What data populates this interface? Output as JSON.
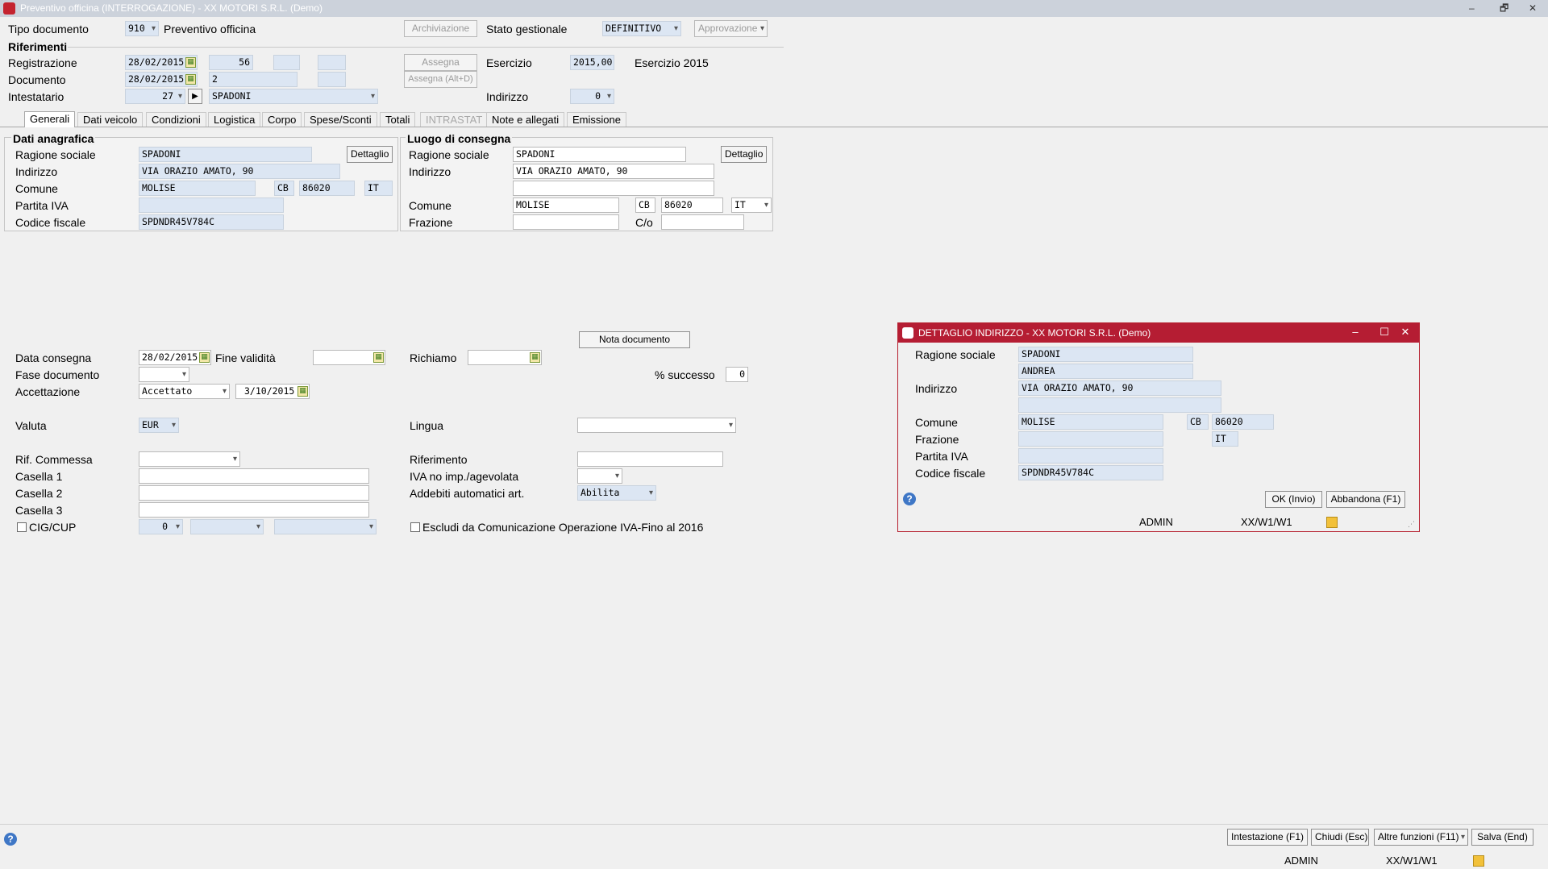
{
  "window": {
    "title": "Preventivo officina (INTERROGAZIONE) - XX  MOTORI S.R.L.  (Demo)",
    "minimize": "–",
    "restore": "🗗",
    "close": "✕"
  },
  "header": {
    "tipo_documento_label": "Tipo documento",
    "tipo_documento_code": "910",
    "tipo_documento_name": "Preventivo officina",
    "archiviazione_button": "Archiviazione",
    "stato_gestionale_label": "Stato gestionale",
    "stato_gestionale_value": "DEFINITIVO",
    "approvazione_button": "Approvazione",
    "riferimenti_title": "Riferimenti",
    "registrazione_label": "Registrazione",
    "registrazione_date": "28/02/2015",
    "registrazione_num": "56",
    "assegna_button": "Assegna",
    "esercizio_label": "Esercizio",
    "esercizio_value": "2015,00",
    "esercizio_desc": "Esercizio 2015",
    "documento_label": "Documento",
    "documento_date": "28/02/2015",
    "documento_num": "2",
    "assegna_alt_button": "Assegna (Alt+D)",
    "intestatario_label": "Intestatario",
    "intestatario_code": "27",
    "intestatario_name": "SPADONI",
    "indirizzo_label": "Indirizzo",
    "indirizzo_value": "0"
  },
  "tabs": [
    "Generali",
    "Dati veicolo",
    "Condizioni",
    "Logistica",
    "Corpo",
    "Spese/Sconti",
    "Totali",
    "INTRASTAT",
    "Note e allegati",
    "Emissione"
  ],
  "anagrafica": {
    "title": "Dati anagrafica",
    "ragione_sociale_label": "Ragione sociale",
    "ragione_sociale": "SPADONI",
    "dettaglio_button": "Dettaglio",
    "indirizzo_label": "Indirizzo",
    "indirizzo": "VIA ORAZIO AMATO, 90",
    "comune_label": "Comune",
    "comune": "MOLISE",
    "provincia": "CB",
    "cap": "86020",
    "nazione": "IT",
    "partita_iva_label": "Partita IVA",
    "partita_iva": "",
    "codice_fiscale_label": "Codice fiscale",
    "codice_fiscale": "SPDNDR45V784C"
  },
  "consegna": {
    "title": "Luogo di consegna",
    "ragione_sociale_label": "Ragione sociale",
    "ragione_sociale": "SPADONI",
    "dettaglio_button": "Dettaglio",
    "indirizzo_label": "Indirizzo",
    "indirizzo": "VIA ORAZIO AMATO, 90",
    "comune_label": "Comune",
    "comune": "MOLISE",
    "provincia": "CB",
    "cap": "86020",
    "nazione": "IT",
    "frazione_label": "Frazione",
    "co_label": "C/o"
  },
  "generali": {
    "nota_documento_button": "Nota documento",
    "data_consegna_label": "Data consegna",
    "data_consegna": "28/02/2015",
    "fine_validita_label": "Fine validità",
    "richiamo_label": "Richiamo",
    "fase_documento_label": "Fase documento",
    "successo_label": "% successo",
    "successo_value": "0",
    "accettazione_label": "Accettazione",
    "accettazione_value": "Accettato",
    "accettazione_date": "3/10/2015",
    "valuta_label": "Valuta",
    "valuta_value": "EUR",
    "lingua_label": "Lingua",
    "rif_commessa_label": "Rif. Commessa",
    "riferimento_label": "Riferimento",
    "casella1_label": "Casella 1",
    "iva_label": "IVA no imp./agevolata",
    "casella2_label": "Casella 2",
    "addebiti_label": "Addebiti automatici art.",
    "addebiti_value": "Abilita",
    "casella3_label": "Casella 3",
    "cig_label": "CIG/CUP",
    "cig_value": "0",
    "escludi_label": "Escludi da Comunicazione Operazione IVA-Fino al 2016"
  },
  "dialog": {
    "title": "DETTAGLIO INDIRIZZO - XX  MOTORI S.R.L.  (Demo)",
    "ragione_sociale_label": "Ragione sociale",
    "ragione_sociale_1": "SPADONI",
    "ragione_sociale_2": "ANDREA",
    "indirizzo_label": "Indirizzo",
    "indirizzo": "VIA ORAZIO AMATO, 90",
    "comune_label": "Comune",
    "comune": "MOLISE",
    "provincia": "CB",
    "cap": "86020",
    "frazione_label": "Frazione",
    "nazione": "IT",
    "partita_iva_label": "Partita IVA",
    "codice_fiscale_label": "Codice fiscale",
    "codice_fiscale": "SPDNDR45V784C",
    "ok_button": "OK (Invio)",
    "abbandona_button": "Abbandona (F1)",
    "user": "ADMIN",
    "path": "XX/W1/W1"
  },
  "footer": {
    "intestazione_button": "Intestazione (F1)",
    "chiudi_button": "Chiudi (Esc)",
    "altre_funzioni_button": "Altre funzioni (F11)",
    "salva_button": "Salva (End)",
    "user": "ADMIN",
    "path": "XX/W1/W1"
  }
}
